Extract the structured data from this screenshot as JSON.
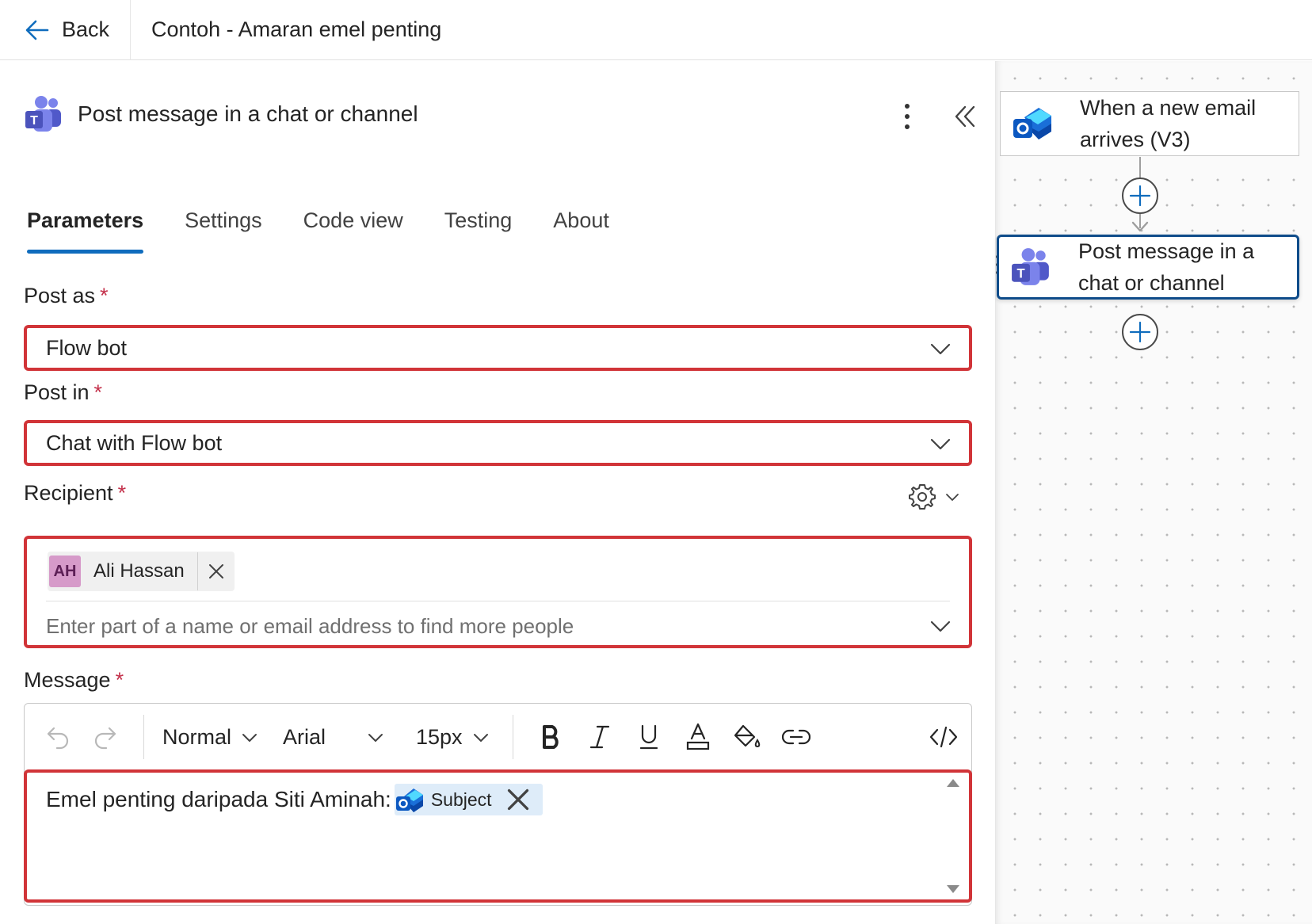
{
  "topbar": {
    "back_label": "Back",
    "flow_title": "Contoh - Amaran emel penting"
  },
  "panel": {
    "title": "Post message in a chat or channel",
    "tabs": [
      {
        "label": "Parameters",
        "active": true
      },
      {
        "label": "Settings",
        "active": false
      },
      {
        "label": "Code view",
        "active": false
      },
      {
        "label": "Testing",
        "active": false
      },
      {
        "label": "About",
        "active": false
      }
    ]
  },
  "fields": {
    "post_as": {
      "label": "Post as",
      "required_mark": "*",
      "value": "Flow bot"
    },
    "post_in": {
      "label": "Post in",
      "required_mark": "*",
      "value": "Chat with Flow bot"
    },
    "recipient": {
      "label": "Recipient",
      "required_mark": "*",
      "chip": {
        "initials": "AH",
        "name": "Ali Hassan"
      },
      "placeholder": "Enter part of a name or email address to find more people"
    },
    "message": {
      "label": "Message",
      "required_mark": "*",
      "toolbar": {
        "style": "Normal",
        "font": "Arial",
        "size": "15px"
      },
      "text": "Emel penting daripada Siti Aminah:",
      "token_label": "Subject"
    }
  },
  "canvas": {
    "trigger_node": "When a new email arrives (V3)",
    "action_node": "Post message in a chat or channel"
  },
  "colors": {
    "accent": "#0f6cbd",
    "highlight_border": "#d13438",
    "required": "#c4314b",
    "avatar_bg": "#d69ac9",
    "token_bg": "#deecf9"
  },
  "icons": {
    "back": "arrow-left-icon",
    "teams": "teams-logo-icon",
    "outlook": "outlook-logo-icon",
    "more": "more-vertical-icon",
    "collapse": "double-chevron-left-icon",
    "settings": "gear-icon",
    "undo": "undo-icon",
    "redo": "redo-icon",
    "bold": "bold-icon",
    "italic": "italic-icon",
    "underline": "underline-icon",
    "font_color": "font-color-icon",
    "highlight": "paint-bucket-icon",
    "link": "link-icon",
    "code": "code-view-icon",
    "add": "plus-circle-icon"
  }
}
